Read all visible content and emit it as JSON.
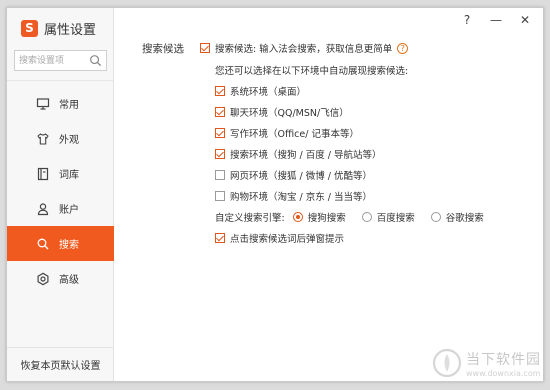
{
  "app": {
    "title": "属性设置",
    "logo_letter": "S"
  },
  "window_controls": {
    "help": "?",
    "minimize": "—",
    "close": "✕"
  },
  "sidebar": {
    "search_placeholder": "搜索设置项",
    "items": [
      {
        "label": "常用",
        "icon": "monitor-icon"
      },
      {
        "label": "外观",
        "icon": "shirt-icon"
      },
      {
        "label": "词库",
        "icon": "book-icon"
      },
      {
        "label": "账户",
        "icon": "user-icon"
      },
      {
        "label": "搜索",
        "icon": "search-icon",
        "active": true
      },
      {
        "label": "高级",
        "icon": "gear-icon"
      }
    ],
    "restore_label": "恢复本页默认设置"
  },
  "content": {
    "section_label": "搜索候选",
    "main_option": {
      "label": "搜索候选: 输入法会搜索，获取信息更简单",
      "checked": true
    },
    "hint": "您还可以选择在以下环境中自动展现搜索候选:",
    "envs": [
      {
        "label": "系统环境（桌面）",
        "checked": true
      },
      {
        "label": "聊天环境（QQ/MSN/飞信）",
        "checked": true
      },
      {
        "label": "写作环境（Office/ 记事本等）",
        "checked": true
      },
      {
        "label": "搜索环境（搜狗 / 百度 / 导航站等）",
        "checked": true
      },
      {
        "label": "网页环境（搜狐 / 微博 / 优酷等）",
        "checked": false
      },
      {
        "label": "购物环境（淘宝 / 京东 / 当当等）",
        "checked": false
      }
    ],
    "engine_label": "自定义搜索引擎:",
    "engines": [
      {
        "label": "搜狗搜索",
        "selected": true
      },
      {
        "label": "百度搜索",
        "selected": false
      },
      {
        "label": "谷歌搜索",
        "selected": false
      }
    ],
    "popup_option": {
      "label": "点击搜索候选词后弹窗提示",
      "checked": true
    }
  },
  "watermark": {
    "text": "当下软件园",
    "url": "www.downxia.com"
  },
  "colors": {
    "accent": "#f05a1e"
  }
}
